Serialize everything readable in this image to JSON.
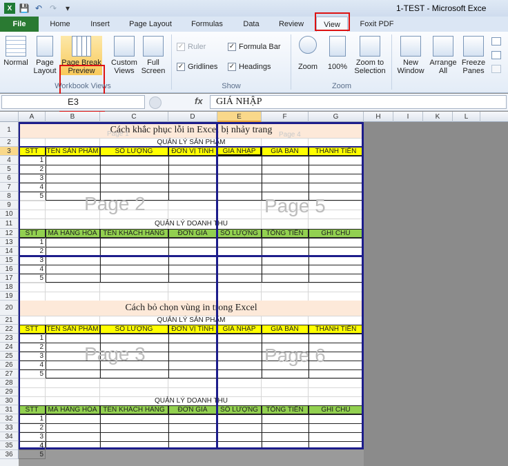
{
  "window": {
    "title": "1-TEST  -  Microsoft Exce"
  },
  "tabs": [
    "File",
    "Home",
    "Insert",
    "Page Layout",
    "Formulas",
    "Data",
    "Review",
    "View",
    "Foxit PDF"
  ],
  "ribbon": {
    "normal": "Normal",
    "page_layout": "Page Layout",
    "page_break_preview": "Page Break Preview",
    "custom_views": "Custom Views",
    "full_screen": "Full Screen",
    "group_workbook_views": "Workbook Views",
    "ruler": "Ruler",
    "formula_bar": "Formula Bar",
    "gridlines": "Gridlines",
    "headings": "Headings",
    "group_show": "Show",
    "zoom": "Zoom",
    "zoom100": "100%",
    "zoom_sel": "Zoom to Selection",
    "group_zoom": "Zoom",
    "new_window": "New Window",
    "arrange_all": "Arrange All",
    "freeze_panes": "Freeze Panes"
  },
  "formula_bar": {
    "name_box": "E3",
    "fx": "fx",
    "value": "GIÁ NHẬP"
  },
  "columns": [
    "A",
    "B",
    "C",
    "D",
    "E",
    "F",
    "G",
    "H",
    "I",
    "K",
    "L"
  ],
  "rows": [
    "1",
    "2",
    "3",
    "4",
    "5",
    "6",
    "7",
    "8",
    "9",
    "10",
    "11",
    "12",
    "13",
    "14",
    "15",
    "16",
    "17",
    "18",
    "19",
    "20",
    "21",
    "22",
    "23",
    "24",
    "25",
    "26",
    "27",
    "28",
    "29",
    "30",
    "31",
    "32",
    "33",
    "34",
    "35",
    "36"
  ],
  "sheet": {
    "title1": "Cách khắc phục lỗi in Excel bị nhảy trang",
    "title2": "Cách bỏ chọn vùng in trong Excel",
    "qlsp": "QUẢN LÝ SẢN PHẨM",
    "qldt": "QUẢN LÝ DOANH THU",
    "hdr_sp": [
      "STT",
      "TÊN SẢN PHẨM",
      "SỐ LƯỢNG",
      "ĐƠN VỊ TÍNH",
      "GIÁ NHẬP",
      "GIÁ BÁN",
      "THÀNH TIỀN"
    ],
    "hdr_dt": [
      "STT",
      "MÃ HÀNG HÓA",
      "TÊN KHÁCH HÀNG",
      "ĐƠN GIÁ",
      "SỐ LƯỢNG",
      "TỔNG TIỀN",
      "GHI CHÚ"
    ],
    "stt": [
      "1",
      "2",
      "3",
      "4",
      "5"
    ],
    "pages": {
      "p1": "Page 1",
      "p2": "Page 2",
      "p3": "Page 3",
      "p4": "Page 4",
      "p5": "Page 5",
      "p6": "Page 6"
    }
  },
  "colors": {
    "yellow": "#ffff00",
    "green": "#92d050",
    "peach": "#fde9d9",
    "page_break": "#1c1c8a",
    "highlight": "#d11111"
  }
}
